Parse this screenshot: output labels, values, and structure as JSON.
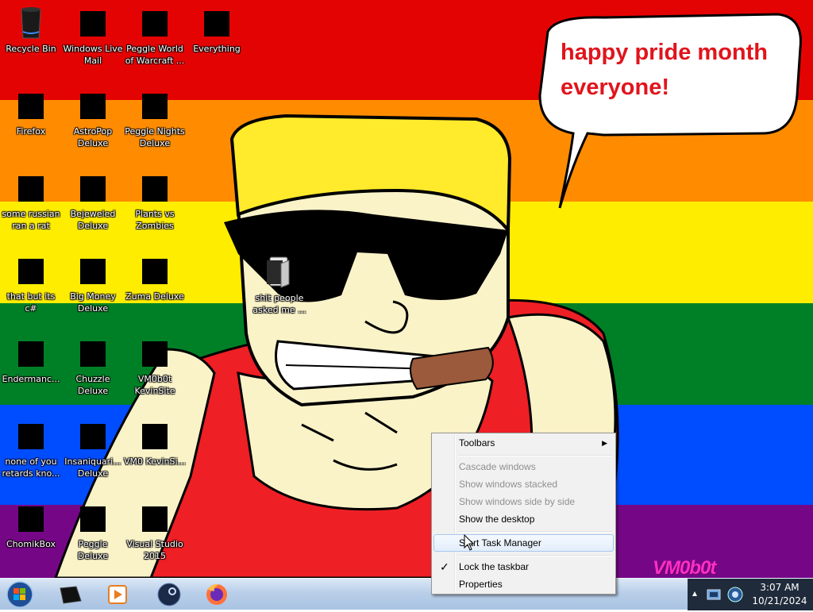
{
  "desktop": {
    "speech_bubble": {
      "text": "happy pride month everyone!"
    },
    "signature": "VM0b0t",
    "folder": {
      "label": "shit people asked me ..."
    },
    "icons": [
      {
        "label": "Recycle Bin",
        "icon": "recycle-bin-icon"
      },
      {
        "label": "Windows Live Mail",
        "icon": "windows-live-mail-icon"
      },
      {
        "label": "Peggle World of Warcraft ...",
        "icon": "peggle-icon"
      },
      {
        "label": "Everything",
        "icon": "everything-search-icon"
      },
      {
        "label": "Firefox",
        "icon": "firefox-icon"
      },
      {
        "label": "AstroPop Deluxe",
        "icon": "astropop-icon"
      },
      {
        "label": "Peggle Nights Deluxe",
        "icon": "peggle-nights-icon"
      },
      {
        "label": "some russian ran a rat",
        "icon": "app-icon"
      },
      {
        "label": "Bejeweled Deluxe",
        "icon": "bejeweled-icon"
      },
      {
        "label": "Plants vs Zombies",
        "icon": "plants-vs-zombies-icon"
      },
      {
        "label": "that but its c#",
        "icon": "app-icon"
      },
      {
        "label": "Big Money Deluxe",
        "icon": "big-money-icon"
      },
      {
        "label": "Zuma Deluxe",
        "icon": "zuma-icon"
      },
      {
        "label": "Endermanc...",
        "icon": "terminal-icon"
      },
      {
        "label": "Chuzzle Deluxe",
        "icon": "chuzzle-icon"
      },
      {
        "label": "VM0b0t KevinSite",
        "icon": "visual-studio-icon"
      },
      {
        "label": "none of you retards kno...",
        "icon": "app-icon"
      },
      {
        "label": "Insaniquari... Deluxe",
        "icon": "insaniquarium-icon"
      },
      {
        "label": "VM0 KevinSi...",
        "icon": "visual-studio-icon"
      },
      {
        "label": "ChomikBox",
        "icon": "chomikbox-icon"
      },
      {
        "label": "Peggle Deluxe",
        "icon": "peggle-icon"
      },
      {
        "label": "Visual Studio 2015",
        "icon": "visual-studio-icon"
      }
    ]
  },
  "context_menu": {
    "items": [
      {
        "label": "Toolbars",
        "state": "enabled",
        "submenu": true
      },
      {
        "label": "Cascade windows",
        "state": "disabled"
      },
      {
        "label": "Show windows stacked",
        "state": "disabled"
      },
      {
        "label": "Show windows side by side",
        "state": "disabled"
      },
      {
        "label": "Show the desktop",
        "state": "enabled"
      },
      {
        "label": "Start Task Manager",
        "state": "hover"
      },
      {
        "label": "Lock the taskbar",
        "state": "enabled",
        "checked": true
      },
      {
        "label": "Properties",
        "state": "enabled"
      }
    ]
  },
  "taskbar": {
    "start": "windows-orb-icon",
    "pinned": [
      "unity-icon",
      "media-player-icon",
      "steam-icon",
      "firefox-icon"
    ],
    "tray_icons": [
      "show-hidden-icons-chevron",
      "network-icon",
      "volume-icon"
    ],
    "clock": {
      "time": "3:07 AM",
      "date": "10/21/2024"
    }
  },
  "colors": {
    "pride_red": "#e40303",
    "pride_orange": "#ff8c00",
    "pride_yellow": "#ffed00",
    "pride_green": "#008026",
    "pride_blue": "#004dff",
    "pride_purple": "#750787",
    "speech_text": "#e1141c"
  }
}
